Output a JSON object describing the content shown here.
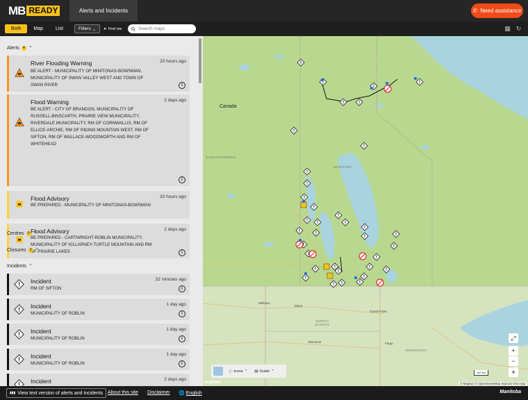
{
  "header": {
    "logo_mb": "MB",
    "logo_ready": "READY",
    "tab": "Alerts and Incidents",
    "need_assistance": "Need assistance"
  },
  "toolbar": {
    "views": [
      "Both",
      "Map",
      "List"
    ],
    "active_view": "Both",
    "filters": "Filters",
    "find_me": "Find me",
    "search_placeholder": "Search maps"
  },
  "sections": {
    "alerts": {
      "label": "Alerts",
      "count": "4"
    },
    "centres": {
      "label": "Centres",
      "count": "0"
    },
    "closures": {
      "label": "Closures",
      "count": "0"
    },
    "incidents": {
      "label": "Incidents",
      "count": ""
    }
  },
  "alerts": [
    {
      "title": "River Flooding Warning",
      "time": "20 hours ago",
      "desc": "BE ALERT - MUNICIPALITY OF MINITONAS-BOWSMAN, MUNICIPALITY OF SWAN VALLEY WEST and TOWN OF SWAN RIVER",
      "level": "warning"
    },
    {
      "title": "Flood Warning",
      "time": "2 days ago",
      "desc": "BE ALERT - CITY OF BRANDON, MUNICIPALITY OF RUSSELL-BINSCARTH, PRAIRIE VIEW MUNICIPALITY, RIVERDALE MUNICIPALITY, RM OF CORNWALLIS, RM OF ELLICE-ARCHIE, RM OF RIDING MOUNTAIN WEST, RM OF SIFTON, RM OF WALLACE-WOODWORTH and RM OF WHITEHEAD",
      "level": "warning"
    },
    {
      "title": "Flood Advisory",
      "time": "20 hours ago",
      "desc": "BE PREPARED - MUNICIPALITY OF MINITONAS-BOWSMAN",
      "level": "advisory"
    },
    {
      "title": "Flood Advisory",
      "time": "2 days ago",
      "desc": "BE PREPARED - CARTWRIGHT-ROBLIN MUNICIPALITY, MUNICIPALITY OF KILLARNEY-TURTLE MOUNTAIN and RM OF PRAIRIE LAKES",
      "level": "advisory"
    }
  ],
  "incidents": [
    {
      "title": "Incident",
      "time": "32 minutes ago",
      "desc": "RM OF SIFTON"
    },
    {
      "title": "Incident",
      "time": "1 day ago",
      "desc": "MUNICIPALITY OF ROBLIN"
    },
    {
      "title": "Incident",
      "time": "1 day ago",
      "desc": "MUNICIPALITY OF ROBLIN"
    },
    {
      "title": "Incident",
      "time": "1 day ago",
      "desc": "MUNICIPALITY OF ROBLIN"
    },
    {
      "title": "Incident",
      "time": "2 days ago",
      "desc": ""
    }
  ],
  "map": {
    "country_label": "Canada",
    "region_labels": [
      "SASKATCHEWAN",
      "MANITOBA",
      "NORTH DAKOTA",
      "MINNESOTA"
    ],
    "cities": [
      "Williston",
      "Minot",
      "Bismarck",
      "Fargo",
      "Grand Forks"
    ],
    "legend_icons": "Icons",
    "legend_guide": "Guide",
    "scale": "100 km",
    "attribution": "© Mapbox © OpenStreetMap  Improve this map",
    "mapbox_logo": "mapbox"
  },
  "footer": {
    "text_version": "View text version of alerts and incidents",
    "about": "About this site",
    "disclaimer": "Disclaimer",
    "language": "English",
    "brand": "Manitoba"
  },
  "colors": {
    "accent": "#f7c11a",
    "warning": "#f7941d",
    "danger": "#f04a1a",
    "incident": "#111111"
  }
}
